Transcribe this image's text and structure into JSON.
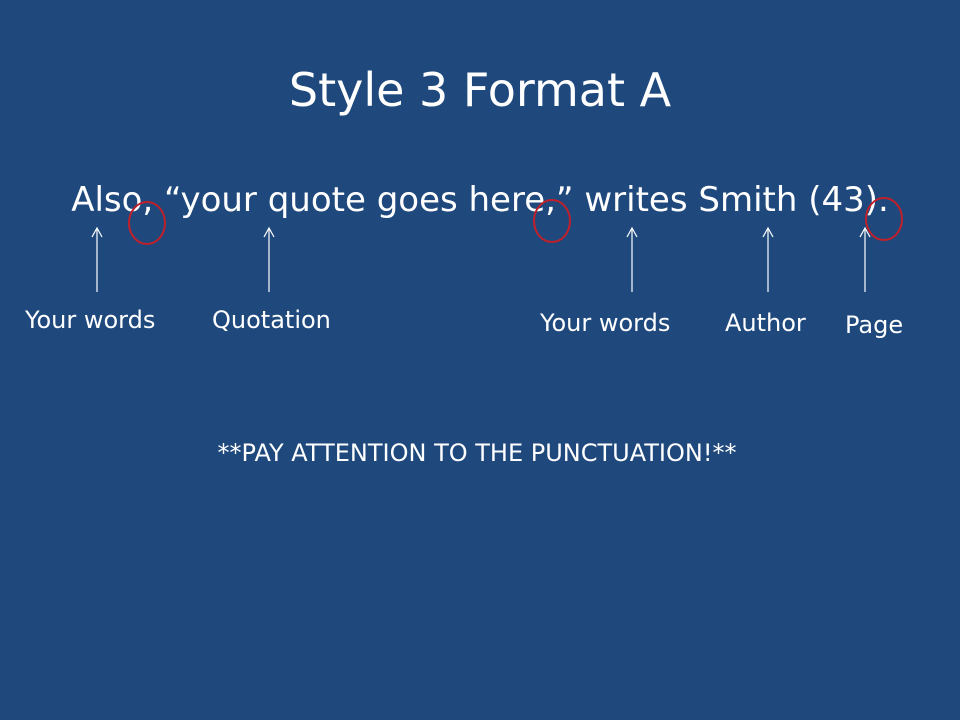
{
  "slide": {
    "title": "Style 3 Format A",
    "sentence": "Also, “your quote goes here,” writes Smith (43).",
    "labels": {
      "your_words_1": "Your words",
      "quotation": "Quotation",
      "your_words_2": "Your words",
      "author": "Author",
      "page": "Page"
    },
    "note": "**PAY ATTENTION TO THE PUNCTUATION!**"
  },
  "colors": {
    "background": "#1f497d",
    "text": "#ffffff",
    "circle": "#c0202a"
  }
}
